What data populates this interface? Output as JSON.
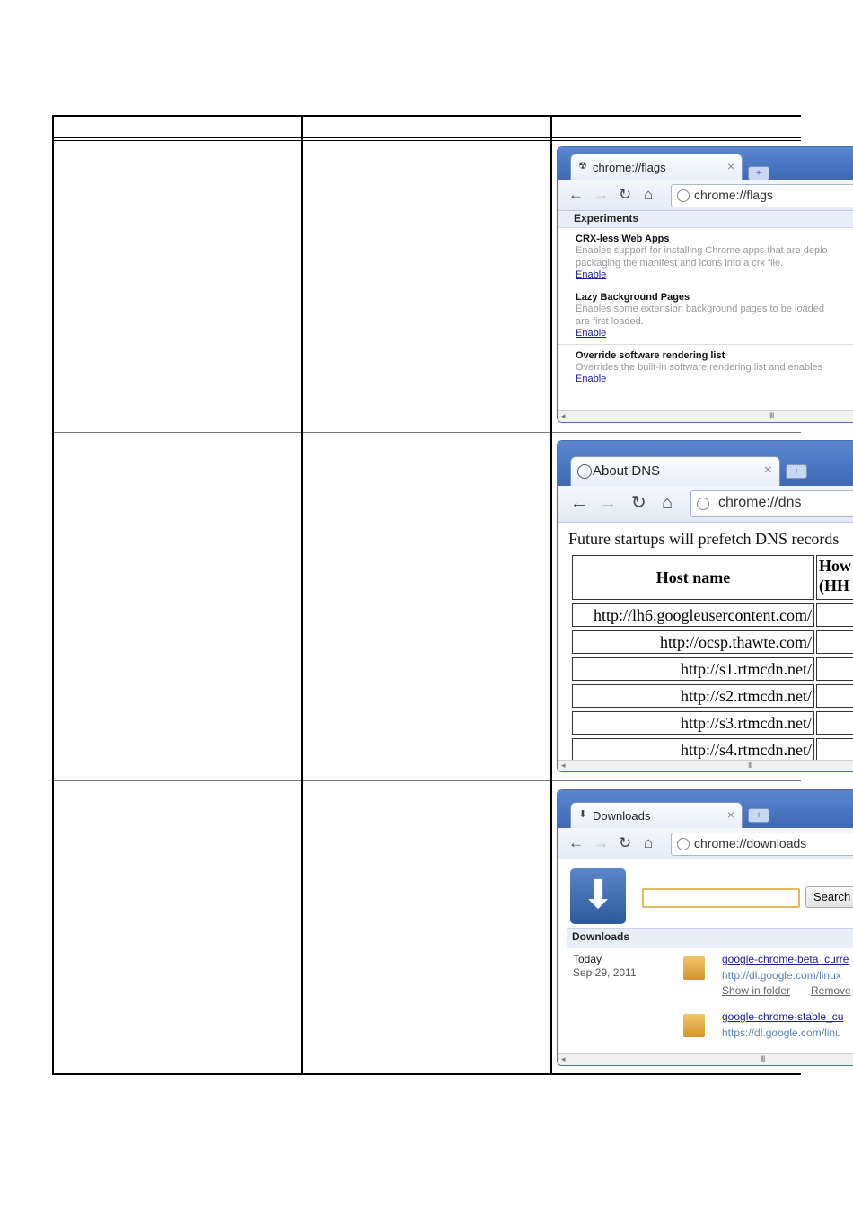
{
  "flags_tab": {
    "title": "chrome://flags",
    "url": "chrome://flags",
    "heading": "Experiments",
    "experiments": [
      {
        "name": "CRX-less Web Apps",
        "desc1": "Enables support for installing Chrome apps that are deplo",
        "desc2": "packaging the manifest and icons into a crx file.",
        "action": "Enable"
      },
      {
        "name": "Lazy Background Pages",
        "desc1": "Enables some extension background pages to be loaded",
        "desc2": "are first loaded.",
        "action": "Enable"
      },
      {
        "name": "Override software rendering list",
        "desc1": "Overrides the built-in software rendering list and enables",
        "desc2": "",
        "action": "Enable"
      }
    ]
  },
  "dns_tab": {
    "title": "About DNS",
    "url": "chrome://dns",
    "caption": "Future startups will prefetch DNS records",
    "col_host": "Host name",
    "col_how": "How",
    "col_how2": "(HH",
    "hosts": [
      "http://lh6.googleusercontent.com/",
      "http://ocsp.thawte.com/",
      "http://s1.rtmcdn.net/",
      "http://s2.rtmcdn.net/",
      "http://s3.rtmcdn.net/",
      "http://s4.rtmcdn.net/"
    ]
  },
  "downloads_tab": {
    "title": "Downloads",
    "url": "chrome://downloads",
    "search_label": "Search",
    "section": "Downloads",
    "date1": "Today",
    "date2": "Sep 29, 2011",
    "items": [
      {
        "file": "google-chrome-beta_curre",
        "src": "http://dl.google.com/linux",
        "show": "Show in folder",
        "remove": "Remove"
      },
      {
        "file": "google-chrome-stable_cu",
        "src": "https://dl.google.com/linu"
      }
    ]
  }
}
